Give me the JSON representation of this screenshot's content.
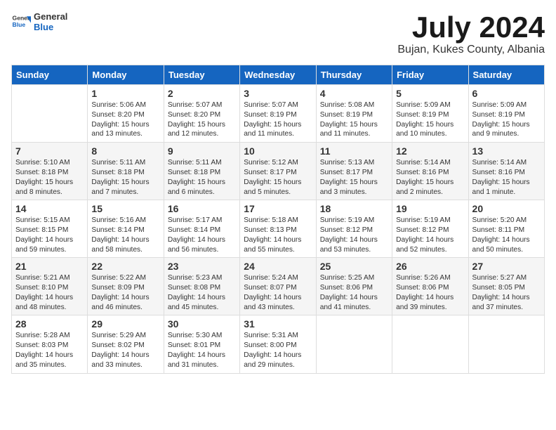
{
  "header": {
    "logo_general": "General",
    "logo_blue": "Blue",
    "month_year": "July 2024",
    "location": "Bujan, Kukes County, Albania"
  },
  "columns": [
    "Sunday",
    "Monday",
    "Tuesday",
    "Wednesday",
    "Thursday",
    "Friday",
    "Saturday"
  ],
  "weeks": [
    [
      {
        "day": "",
        "info": ""
      },
      {
        "day": "1",
        "info": "Sunrise: 5:06 AM\nSunset: 8:20 PM\nDaylight: 15 hours\nand 13 minutes."
      },
      {
        "day": "2",
        "info": "Sunrise: 5:07 AM\nSunset: 8:20 PM\nDaylight: 15 hours\nand 12 minutes."
      },
      {
        "day": "3",
        "info": "Sunrise: 5:07 AM\nSunset: 8:19 PM\nDaylight: 15 hours\nand 11 minutes."
      },
      {
        "day": "4",
        "info": "Sunrise: 5:08 AM\nSunset: 8:19 PM\nDaylight: 15 hours\nand 11 minutes."
      },
      {
        "day": "5",
        "info": "Sunrise: 5:09 AM\nSunset: 8:19 PM\nDaylight: 15 hours\nand 10 minutes."
      },
      {
        "day": "6",
        "info": "Sunrise: 5:09 AM\nSunset: 8:19 PM\nDaylight: 15 hours\nand 9 minutes."
      }
    ],
    [
      {
        "day": "7",
        "info": "Sunrise: 5:10 AM\nSunset: 8:18 PM\nDaylight: 15 hours\nand 8 minutes."
      },
      {
        "day": "8",
        "info": "Sunrise: 5:11 AM\nSunset: 8:18 PM\nDaylight: 15 hours\nand 7 minutes."
      },
      {
        "day": "9",
        "info": "Sunrise: 5:11 AM\nSunset: 8:18 PM\nDaylight: 15 hours\nand 6 minutes."
      },
      {
        "day": "10",
        "info": "Sunrise: 5:12 AM\nSunset: 8:17 PM\nDaylight: 15 hours\nand 5 minutes."
      },
      {
        "day": "11",
        "info": "Sunrise: 5:13 AM\nSunset: 8:17 PM\nDaylight: 15 hours\nand 3 minutes."
      },
      {
        "day": "12",
        "info": "Sunrise: 5:14 AM\nSunset: 8:16 PM\nDaylight: 15 hours\nand 2 minutes."
      },
      {
        "day": "13",
        "info": "Sunrise: 5:14 AM\nSunset: 8:16 PM\nDaylight: 15 hours\nand 1 minute."
      }
    ],
    [
      {
        "day": "14",
        "info": "Sunrise: 5:15 AM\nSunset: 8:15 PM\nDaylight: 14 hours\nand 59 minutes."
      },
      {
        "day": "15",
        "info": "Sunrise: 5:16 AM\nSunset: 8:14 PM\nDaylight: 14 hours\nand 58 minutes."
      },
      {
        "day": "16",
        "info": "Sunrise: 5:17 AM\nSunset: 8:14 PM\nDaylight: 14 hours\nand 56 minutes."
      },
      {
        "day": "17",
        "info": "Sunrise: 5:18 AM\nSunset: 8:13 PM\nDaylight: 14 hours\nand 55 minutes."
      },
      {
        "day": "18",
        "info": "Sunrise: 5:19 AM\nSunset: 8:12 PM\nDaylight: 14 hours\nand 53 minutes."
      },
      {
        "day": "19",
        "info": "Sunrise: 5:19 AM\nSunset: 8:12 PM\nDaylight: 14 hours\nand 52 minutes."
      },
      {
        "day": "20",
        "info": "Sunrise: 5:20 AM\nSunset: 8:11 PM\nDaylight: 14 hours\nand 50 minutes."
      }
    ],
    [
      {
        "day": "21",
        "info": "Sunrise: 5:21 AM\nSunset: 8:10 PM\nDaylight: 14 hours\nand 48 minutes."
      },
      {
        "day": "22",
        "info": "Sunrise: 5:22 AM\nSunset: 8:09 PM\nDaylight: 14 hours\nand 46 minutes."
      },
      {
        "day": "23",
        "info": "Sunrise: 5:23 AM\nSunset: 8:08 PM\nDaylight: 14 hours\nand 45 minutes."
      },
      {
        "day": "24",
        "info": "Sunrise: 5:24 AM\nSunset: 8:07 PM\nDaylight: 14 hours\nand 43 minutes."
      },
      {
        "day": "25",
        "info": "Sunrise: 5:25 AM\nSunset: 8:06 PM\nDaylight: 14 hours\nand 41 minutes."
      },
      {
        "day": "26",
        "info": "Sunrise: 5:26 AM\nSunset: 8:06 PM\nDaylight: 14 hours\nand 39 minutes."
      },
      {
        "day": "27",
        "info": "Sunrise: 5:27 AM\nSunset: 8:05 PM\nDaylight: 14 hours\nand 37 minutes."
      }
    ],
    [
      {
        "day": "28",
        "info": "Sunrise: 5:28 AM\nSunset: 8:03 PM\nDaylight: 14 hours\nand 35 minutes."
      },
      {
        "day": "29",
        "info": "Sunrise: 5:29 AM\nSunset: 8:02 PM\nDaylight: 14 hours\nand 33 minutes."
      },
      {
        "day": "30",
        "info": "Sunrise: 5:30 AM\nSunset: 8:01 PM\nDaylight: 14 hours\nand 31 minutes."
      },
      {
        "day": "31",
        "info": "Sunrise: 5:31 AM\nSunset: 8:00 PM\nDaylight: 14 hours\nand 29 minutes."
      },
      {
        "day": "",
        "info": ""
      },
      {
        "day": "",
        "info": ""
      },
      {
        "day": "",
        "info": ""
      }
    ]
  ]
}
